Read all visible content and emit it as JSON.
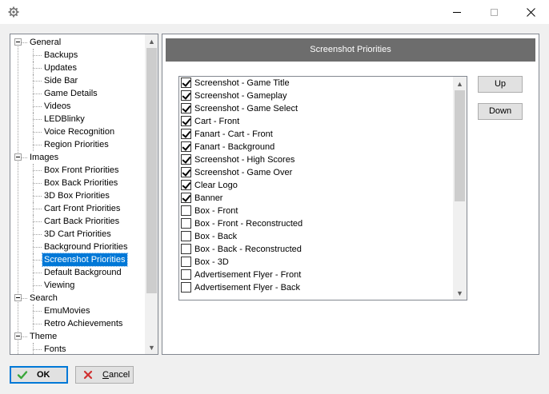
{
  "window": {
    "icons": {
      "app": "gear-icon",
      "minimize": "minimize-icon",
      "maximize": "maximize-icon",
      "close": "close-icon"
    }
  },
  "tree": {
    "items": [
      {
        "label": "General",
        "level": 0
      },
      {
        "label": "Backups",
        "level": 1
      },
      {
        "label": "Updates",
        "level": 1
      },
      {
        "label": "Side Bar",
        "level": 1
      },
      {
        "label": "Game Details",
        "level": 1
      },
      {
        "label": "Videos",
        "level": 1
      },
      {
        "label": "LEDBlinky",
        "level": 1
      },
      {
        "label": "Voice Recognition",
        "level": 1
      },
      {
        "label": "Region Priorities",
        "level": 1
      },
      {
        "label": "Images",
        "level": 0
      },
      {
        "label": "Box Front Priorities",
        "level": 1
      },
      {
        "label": "Box Back Priorities",
        "level": 1
      },
      {
        "label": "3D Box Priorities",
        "level": 1
      },
      {
        "label": "Cart Front Priorities",
        "level": 1
      },
      {
        "label": "Cart Back Priorities",
        "level": 1
      },
      {
        "label": "3D Cart Priorities",
        "level": 1
      },
      {
        "label": "Background Priorities",
        "level": 1
      },
      {
        "label": "Screenshot Priorities",
        "level": 1,
        "selected": true
      },
      {
        "label": "Default Background",
        "level": 1
      },
      {
        "label": "Viewing",
        "level": 1
      },
      {
        "label": "Search",
        "level": 0
      },
      {
        "label": "EmuMovies",
        "level": 1
      },
      {
        "label": "Retro Achievements",
        "level": 1
      },
      {
        "label": "Theme",
        "level": 0
      },
      {
        "label": "Fonts",
        "level": 1
      }
    ]
  },
  "panel": {
    "title": "Screenshot Priorities",
    "priorities": [
      {
        "label": "Screenshot - Game Title",
        "checked": true
      },
      {
        "label": "Screenshot - Gameplay",
        "checked": true
      },
      {
        "label": "Screenshot - Game Select",
        "checked": true
      },
      {
        "label": "Cart - Front",
        "checked": true
      },
      {
        "label": "Fanart - Cart - Front",
        "checked": true
      },
      {
        "label": "Fanart - Background",
        "checked": true
      },
      {
        "label": "Screenshot - High Scores",
        "checked": true
      },
      {
        "label": "Screenshot - Game Over",
        "checked": true
      },
      {
        "label": "Clear Logo",
        "checked": true
      },
      {
        "label": "Banner",
        "checked": true
      },
      {
        "label": "Box - Front",
        "checked": false
      },
      {
        "label": "Box - Front - Reconstructed",
        "checked": false
      },
      {
        "label": "Box - Back",
        "checked": false
      },
      {
        "label": "Box - Back - Reconstructed",
        "checked": false
      },
      {
        "label": "Box - 3D",
        "checked": false
      },
      {
        "label": "Advertisement Flyer - Front",
        "checked": false
      },
      {
        "label": "Advertisement Flyer - Back",
        "checked": false
      }
    ],
    "up_label": "Up",
    "down_label": "Down"
  },
  "footer": {
    "ok_label": "OK",
    "cancel_label": "Cancel",
    "ok_icon": "check-icon",
    "cancel_icon": "x-icon",
    "colors": {
      "ok_check": "#3aa63a",
      "cancel_x": "#d03030",
      "selection": "#0078d7"
    }
  }
}
